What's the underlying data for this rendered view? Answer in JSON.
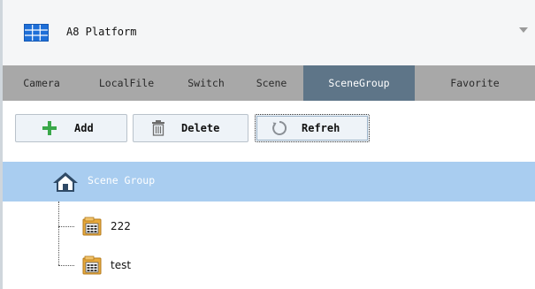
{
  "app": {
    "title": "A8 Platform",
    "grid_icon": "grid-icon",
    "dropdown_icon": "chevron-down-icon"
  },
  "tabs": [
    {
      "label": "Camera",
      "active": false
    },
    {
      "label": "LocalFile",
      "active": false
    },
    {
      "label": "Switch",
      "active": false
    },
    {
      "label": "Scene",
      "active": false
    },
    {
      "label": "SceneGroup",
      "active": true
    },
    {
      "label": "Favorite",
      "active": false
    }
  ],
  "toolbar": {
    "add_label": "Add",
    "delete_label": "Delete",
    "refresh_label": "Refreh"
  },
  "tree": {
    "root_label": "Scene Group",
    "items": [
      {
        "label": "222",
        "icon": "scene-folder-icon"
      },
      {
        "label": "test",
        "icon": "scene-folder-icon"
      }
    ]
  },
  "colors": {
    "active_tab": "#5e7588",
    "tabbar": "#a8a8a8",
    "selected_row": "#a9cdf0",
    "brand_blue": "#1e6fd8",
    "add_green": "#3aa84a"
  }
}
